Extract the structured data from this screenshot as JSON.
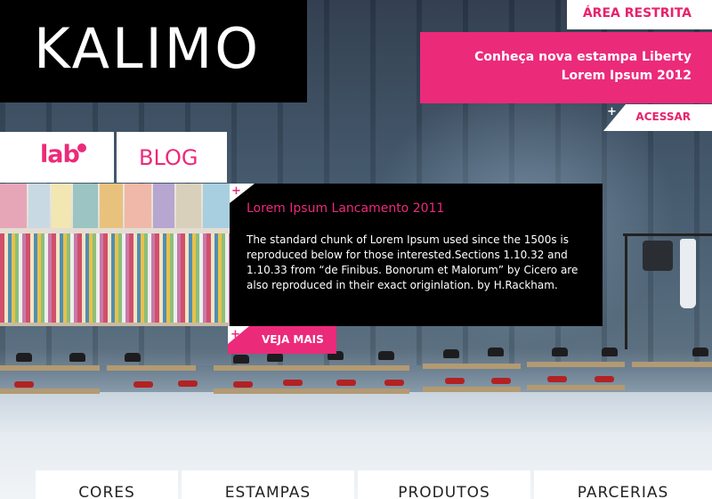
{
  "brand": {
    "logo_text": "KALIMO",
    "accent": "#ec2a7a"
  },
  "header": {
    "restricted_area": "ÁREA RESTRITA",
    "promo": {
      "line1": "Conheça nova estampa Liberty",
      "line2": "Lorem Ipsum 2012"
    },
    "access_label": "ACESSAR",
    "plus_icon": "+"
  },
  "blog": {
    "lab_label": "lab",
    "blog_label": "BLOG",
    "article": {
      "title": "Lorem Ipsum Lancamento 2011",
      "body": "The standard chunk of Lorem Ipsum used since the 1500s is reproduced below for those interested.Sections 1.10.32 and 1.10.33 from “de Finibus. Bonorum et Malorum” by Cicero are also reproduced in their exact originlation. by H.Rackham.",
      "more_label": "VEJA MAIS"
    }
  },
  "nav": {
    "items": [
      {
        "label": "CORES"
      },
      {
        "label": "ESTAMPAS"
      },
      {
        "label": "PRODUTOS"
      },
      {
        "label": "PARCERIAS"
      }
    ]
  }
}
